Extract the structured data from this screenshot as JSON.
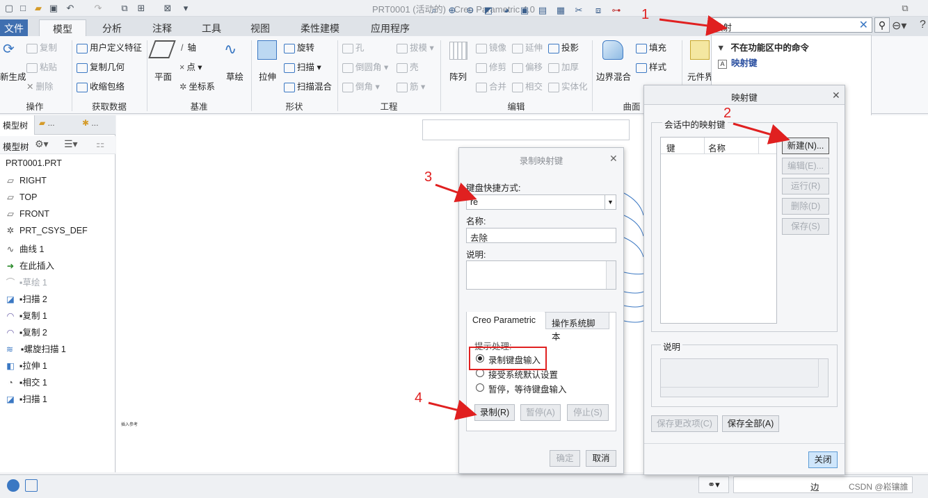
{
  "window": {
    "title": "PRT0001 (活动的) - Creo Parametric 4.0"
  },
  "tabs": [
    "文件",
    "模型",
    "分析",
    "注释",
    "工具",
    "视图",
    "柔性建模",
    "应用程序"
  ],
  "ribbon": {
    "operations": {
      "regen": "新生成",
      "copy": "复制",
      "paste": "粘贴",
      "delete": "删除",
      "label": "操作"
    },
    "get_data": {
      "udf": "用户定义特征",
      "copy_geom": "复制几何",
      "shrinkwrap": "收缩包络",
      "label": "获取数据"
    },
    "datum": {
      "plane": "平面",
      "axis": "轴",
      "point": "点",
      "csys": "坐标系",
      "sketch": "草绘",
      "label": "基准"
    },
    "shapes": {
      "extrude": "拉伸",
      "revolve": "旋转",
      "sweep": "扫描",
      "swept_blend": "扫描混合",
      "label": "形状"
    },
    "engineering": {
      "hole": "孔",
      "round": "倒圆角",
      "chamfer": "倒角",
      "draft": "拔模",
      "shell": "壳",
      "rib": "筋",
      "label": "工程"
    },
    "editing": {
      "pattern": "阵列",
      "mirror": "镜像",
      "trim": "修剪",
      "merge": "合并",
      "extend": "延伸",
      "offset": "偏移",
      "intersect": "相交",
      "project": "投影",
      "thicken": "加厚",
      "solidify": "实体化",
      "label": "编辑"
    },
    "surfaces": {
      "boundary_blend": "边界混合",
      "fill": "填充",
      "style": "样式",
      "label": "曲面"
    },
    "component": {
      "label": "元件界"
    }
  },
  "search": {
    "value": "映射",
    "results_header": "不在功能区中的命令",
    "result_item": "映射键"
  },
  "left_panel": {
    "tabs": [
      "模型树",
      "..."
    ],
    "toolbar_label": "模型树",
    "tree": [
      "PRT0001.PRT",
      "RIGHT",
      "TOP",
      "FRONT",
      "PRT_CSYS_DEF",
      "曲线 1",
      "在此插入",
      "草绘 1",
      "扫描 2",
      "复制 1",
      "复制 2",
      "螺旋扫描 1",
      "拉伸 1",
      "相交 1",
      "扫描 1"
    ]
  },
  "record_dialog": {
    "title": "录制映射键",
    "shortcut_label": "键盘快捷方式:",
    "shortcut_value": "re",
    "name_label": "名称:",
    "name_value": "去除",
    "desc_label": "说明:",
    "tabs": [
      "Creo Parametric",
      "操作系统脚本"
    ],
    "prompt_label": "提示处理:",
    "options": [
      "录制键盘输入",
      "接受系统默认设置",
      "暂停，等待键盘输入"
    ],
    "buttons": {
      "record": "录制(R)",
      "pause": "暂停(A)",
      "stop": "停止(S)",
      "ok": "确定",
      "cancel": "取消"
    }
  },
  "mapkeys_dialog": {
    "title": "映射键",
    "group_label": "会话中的映射键",
    "col_key": "键",
    "col_name": "名称",
    "buttons": {
      "new": "新建(N)...",
      "edit": "编辑(E)...",
      "run": "运行(R)",
      "delete": "删除(D)",
      "save": "保存(S)"
    },
    "desc_label": "说明",
    "save_changes": "保存更改项(C)",
    "save_all": "保存全部(A)",
    "close": "关闭"
  },
  "canvas": {
    "small_text": "插入参考"
  },
  "status_bar": {
    "edge_label": "边",
    "watermark": "CSDN @崧镶誰"
  },
  "annotations": [
    "1",
    "2",
    "3",
    "4"
  ],
  "colors": {
    "accent": "#3f6fb0",
    "annotation": "#e02020",
    "highlight_box": "#e02020"
  }
}
